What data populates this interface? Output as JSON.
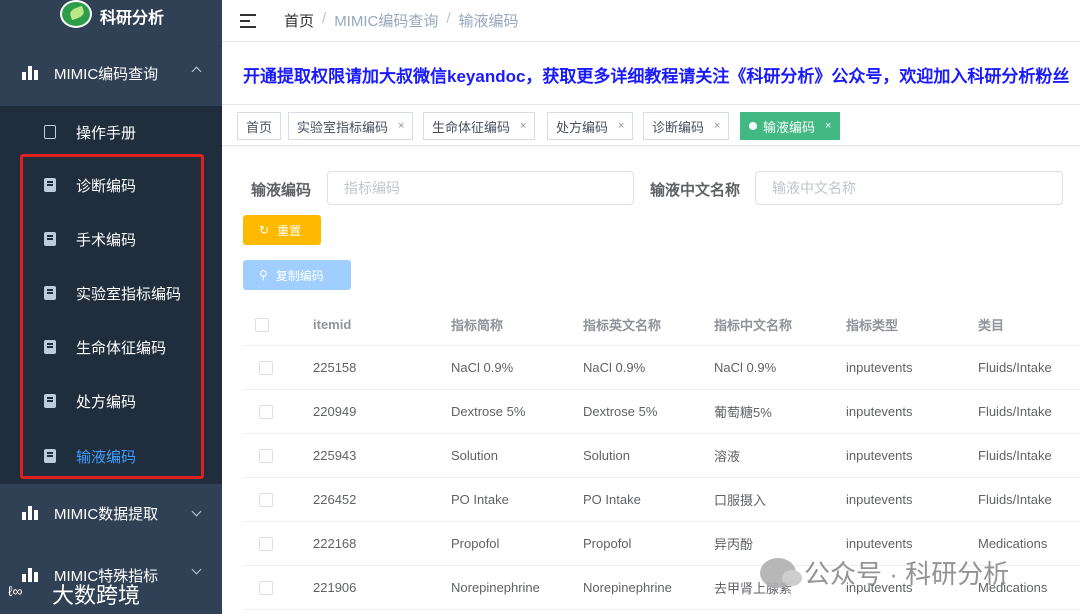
{
  "app": {
    "logo_text": "科研分析"
  },
  "sidebar": {
    "group1": {
      "label": "MIMIC编码查询"
    },
    "items": [
      {
        "label": "操作手册"
      },
      {
        "label": "诊断编码"
      },
      {
        "label": "手术编码"
      },
      {
        "label": "实验室指标编码"
      },
      {
        "label": "生命体征编码"
      },
      {
        "label": "处方编码"
      },
      {
        "label": "输液编码"
      }
    ],
    "group2": {
      "label": "MIMIC数据提取"
    },
    "group3": {
      "label": "MIMIC特殊指标"
    },
    "active_color": "#409eff"
  },
  "breadcrumb": {
    "home": "首页",
    "sep1": "/",
    "level1": "MIMIC编码查询",
    "sep2": "/",
    "current": "输液编码"
  },
  "notice": "开通提取权限请加大叔微信keyandoc，获取更多详细教程请关注《科研分析》公众号，欢迎加入科研分析粉丝",
  "tags": [
    {
      "label": "首页"
    },
    {
      "label": "实验室指标编码",
      "close": "×"
    },
    {
      "label": "生命体征编码",
      "close": "×"
    },
    {
      "label": "处方编码",
      "close": "×"
    },
    {
      "label": "诊断编码",
      "close": "×"
    },
    {
      "label": "输液编码",
      "close": "×"
    }
  ],
  "form": {
    "code_label": "输液编码",
    "code_placeholder": "指标编码",
    "cn_label": "输液中文名称",
    "cn_placeholder": "输液中文名称",
    "reset_label": "重置",
    "copy_label": "复制编码"
  },
  "table": {
    "headers": [
      "itemid",
      "指标简称",
      "指标英文名称",
      "指标中文名称",
      "指标类型",
      "类目"
    ],
    "rows": [
      [
        "225158",
        "NaCl 0.9%",
        "NaCl 0.9%",
        "NaCl 0.9%",
        "inputevents",
        "Fluids/Intake"
      ],
      [
        "220949",
        "Dextrose 5%",
        "Dextrose 5%",
        "葡萄糖5%",
        "inputevents",
        "Fluids/Intake"
      ],
      [
        "225943",
        "Solution",
        "Solution",
        "溶液",
        "inputevents",
        "Fluids/Intake"
      ],
      [
        "226452",
        "PO Intake",
        "PO Intake",
        "口服摄入",
        "inputevents",
        "Fluids/Intake"
      ],
      [
        "222168",
        "Propofol",
        "Propofol",
        "异丙酚",
        "inputevents",
        "Medications"
      ],
      [
        "221906",
        "Norepinephrine",
        "Norepinephrine",
        "去甲肾上腺素",
        "inputevents",
        "Medications"
      ]
    ]
  },
  "watermark": {
    "text": "公众号 · 科研分析",
    "text2": "大数跨境"
  },
  "colors": {
    "sidebar_bg": "#304156",
    "submenu_bg": "#1f2d3d",
    "tag_active": "#42b983",
    "reset_btn": "#ffba00",
    "copy_btn": "#a0cfff",
    "notice": "#1a1aff",
    "highlight_box": "#e02020"
  }
}
